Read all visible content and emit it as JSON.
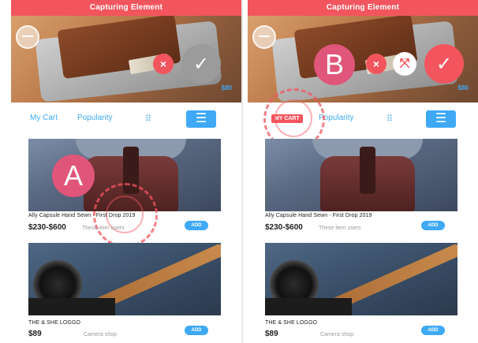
{
  "panels": [
    {
      "title": "Capturing Element",
      "toolbar": {
        "left": "My Cart",
        "mid": "Popularity",
        "grid_icon": "grid-icon",
        "menu_icon": "menu-icon"
      },
      "hero": {
        "price": "$80",
        "confirm_icon": "check-icon",
        "cancel_icon": "close-icon"
      },
      "marker": "A",
      "cards": [
        {
          "title": "Ally Capsule Hand Sewn - First Drop 2019",
          "price": "$230-$600",
          "sub": "These item users",
          "add": "ADD"
        },
        {
          "title": "THE & SHE LOGGO",
          "price": "$89",
          "sub": "Camera shop",
          "add": "ADD"
        }
      ]
    },
    {
      "title": "Capturing Element",
      "toolbar": {
        "left_pill": "MY CART",
        "mid": "Popularity",
        "grid_icon": "grid-icon",
        "menu_icon": "menu-icon"
      },
      "hero": {
        "price": "$80",
        "confirm_icon": "check-icon",
        "cancel_icon": "close-icon",
        "expand_icon": "expand-icon"
      },
      "marker": "B",
      "cards": [
        {
          "title": "Ally Capsule Hand Sewn - First Drop 2019",
          "price": "$230-$600",
          "sub": "These item users",
          "add": "ADD"
        },
        {
          "title": "THE & SHE LOGGO",
          "price": "$89",
          "sub": "Camera shop",
          "add": "ADD"
        }
      ]
    }
  ],
  "colors": {
    "accent_red": "#f2555e",
    "accent_blue": "#3fa9f5",
    "marker_pink": "#e0557a"
  }
}
